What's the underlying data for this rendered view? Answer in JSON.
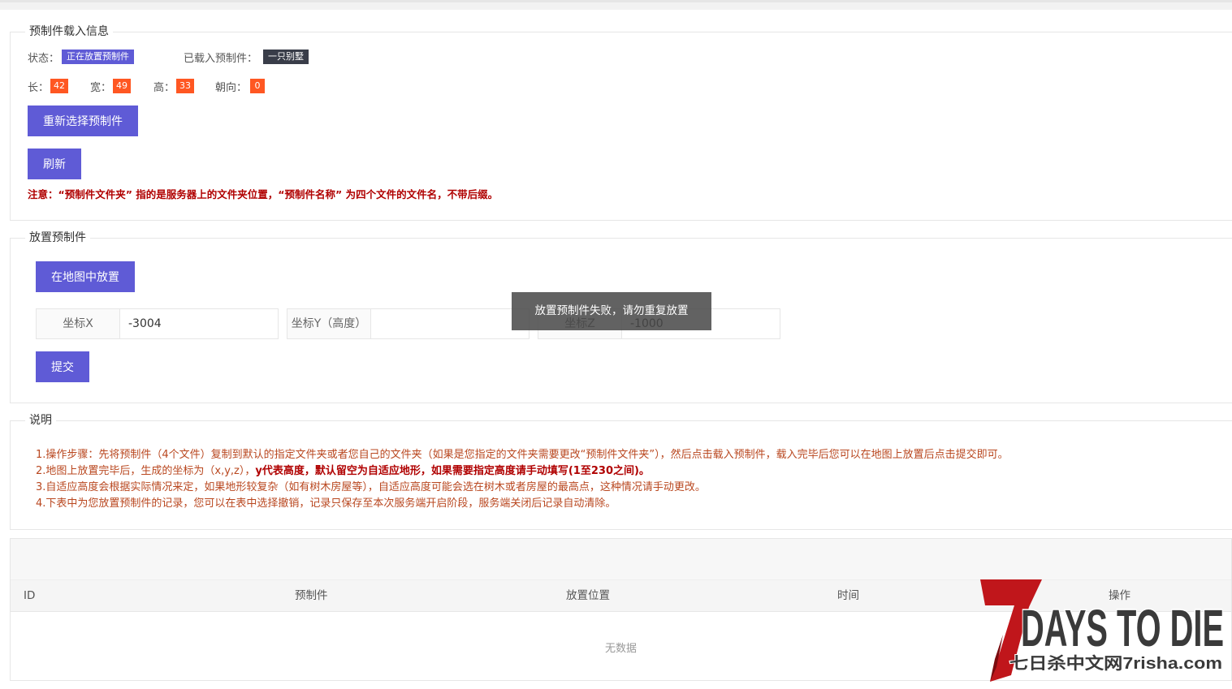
{
  "load_section": {
    "legend": "预制件载入信息",
    "status_label": "状态：",
    "status_value": "正在放置预制件",
    "loaded_label": "已载入预制件：",
    "loaded_value": "一只别墅",
    "length_label": "长：",
    "length_value": "42",
    "width_label": "宽：",
    "width_value": "49",
    "height_label": "高：",
    "height_value": "33",
    "orient_label": "朝向：",
    "orient_value": "0",
    "reselect_button": "重新选择预制件",
    "refresh_button": "刷新",
    "notice": "注意：“预制件文件夹” 指的是服务器上的文件夹位置，“预制件名称” 为四个文件的文件名，不带后缀。"
  },
  "place_section": {
    "legend": "放置预制件",
    "place_button": "在地图中放置",
    "x_label": "坐标X",
    "x_value": "-3004",
    "y_label": "坐标Y（高度）",
    "y_value": "",
    "z_label": "坐标Z",
    "z_value": "-1000",
    "submit_button": "提交"
  },
  "toast": "放置预制件失败，请勿重复放置",
  "desc_section": {
    "legend": "说明",
    "line1": "1.操作步骤：先将预制件（4个文件）复制到默认的指定文件夹或者您自己的文件夹（如果是您指定的文件夹需要更改“预制件文件夹”），然后点击载入预制件，载入完毕后您可以在地图上放置后点击提交即可。",
    "line2_a": "2.地图上放置完毕后，生成的坐标为（x,y,z），",
    "line2_b": "y代表高度，默认留空为自适应地形，如果需要指定高度请手动填写(1至230之间)。",
    "line3": "3.自适应高度会根据实际情况来定，如果地形较复杂（如有树木房屋等），自适应高度可能会选在树木或者房屋的最高点，这种情况请手动更改。",
    "line4": "4.下表中为您放置预制件的记录，您可以在表中选择撤销，记录只保存至本次服务端开启阶段，服务端关闭后记录自动清除。"
  },
  "table": {
    "columns": [
      "ID",
      "预制件",
      "放置位置",
      "时间",
      "操作"
    ],
    "rows": [],
    "empty_text": "无数据"
  },
  "watermark": {
    "logo_text": "7 DAYS TO DIE",
    "subtitle": "七日杀中文网7risha.com"
  },
  "colors": {
    "primary": "#5f5bd6",
    "tag_dark": "#393d49",
    "number_badge": "#ff5722",
    "notice": "#b00000",
    "desc_text": "#b9471f"
  }
}
